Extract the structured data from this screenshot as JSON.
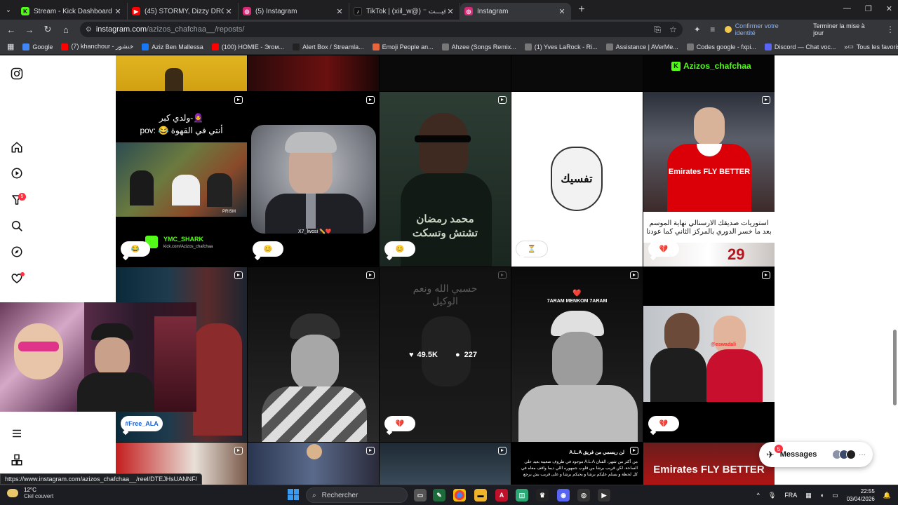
{
  "browser": {
    "tabs": [
      {
        "title": "Stream - Kick Dashboard",
        "color": "#53fc18",
        "glyph": "K",
        "active": false
      },
      {
        "title": "(45) STORMY, Dizzy DROS - NI",
        "color": "#ff0000",
        "glyph": "▶",
        "active": false
      },
      {
        "title": "(5) Instagram",
        "color": "#d62976",
        "glyph": "◎",
        "active": false
      },
      {
        "title": "TikTok | (xiil_w@) ⁻ ﻗﯿـــﺖ",
        "color": "#111111",
        "glyph": "♪",
        "active": false
      },
      {
        "title": "Instagram",
        "color": "#d62976",
        "glyph": "◎",
        "active": true
      }
    ],
    "url_host": "instagram.com",
    "url_path": "/azizos_chafchaa__/reposts/",
    "identity_label": "Confirmer votre identité",
    "update_label": "Terminer la mise à jour",
    "bookmarks": [
      {
        "label": "Google",
        "color": "#4285f4"
      },
      {
        "label": "(7) khanchour - خنشور",
        "color": "#ff0000"
      },
      {
        "label": "Aziz Ben Mallessa",
        "color": "#1877f2"
      },
      {
        "label": "(100) HOMIE - Эгом...",
        "color": "#ff0000"
      },
      {
        "label": "Alert Box / Streamla...",
        "color": "#222222"
      },
      {
        "label": "Emoji People an...",
        "color": "#e8643c"
      },
      {
        "label": "Ahzee (Songs Remix...",
        "color": "#777777"
      },
      {
        "label": "(1) Yves LaRock - Ri...",
        "color": "#777777"
      },
      {
        "label": "Assistance | AVerMe...",
        "color": "#777777"
      },
      {
        "label": "Codes google - fxpi...",
        "color": "#777777"
      },
      {
        "label": "Discord — Chat voc...",
        "color": "#5865f2"
      }
    ],
    "all_favorites_label": "Tous les favoris",
    "status_url": "https://www.instagram.com/azizos_chafchaa__/reel/DTEJHsUANNF/"
  },
  "instagram": {
    "nav_badge_reels": "5",
    "top_row": {
      "username_tag": "Azizos_chafchaa"
    },
    "posts": {
      "p1": {
        "line1": "ولدي كبر-🧕",
        "line2": "pov: 😂 أنتي في القهوة",
        "channel": "YMC_SHARK",
        "channel_sub": "kick.com/Azizos_chafchaa",
        "bubble": "😂",
        "watermark": "PRISM"
      },
      "p2": {
        "caption": "X7_lwosi ✏️❤️",
        "bubble": "😊"
      },
      "p3": {
        "title": "محمد رمضان",
        "subtitle": "تشتش وتسكت",
        "bubble": "😊"
      },
      "p4": {
        "logo_text": "تفسيك",
        "bubble": "⏳"
      },
      "p5": {
        "jersey": "Emirates FLY BETTER",
        "caption_l1": "استوريات صديقك الارسنالي نهاية الموسم",
        "caption_l2": "بعد ما خسر الدوري بالمركز الثاني كما عودنا",
        "number": "29",
        "bubble": "💔"
      },
      "p6": {
        "bubble": "#Free_ALA"
      },
      "p8": {
        "overlay_text_l1": "حسبي الله ونعم",
        "overlay_text_l2": "الوكيل",
        "likes": "49.5K",
        "comments": "227",
        "bubble": "💔"
      },
      "p9": {
        "overlay_text": "7ARAM MENKOM 7ARAM",
        "heart": "❤️"
      },
      "p10": {
        "overlay_text": "@eswadali",
        "bubble": "💔"
      },
      "p13": {
        "title": "A.L.A لن ريسمي من فريق",
        "body": "من أكثر من شهر، الفنان A.L.A موجود في ظروف صعيبة بعيد على الساحة. لكن قريب برشا من قلوب جمهوره اللي ديما واقف معاه في كل لحظة و يسلم عليكم برشا و يحبكم برشا و على قريب بش يرجع"
      },
      "p14": {
        "jersey": "Emirates FLY BETTER"
      }
    },
    "messages": {
      "label": "Messages",
      "badge": "5"
    }
  },
  "taskbar": {
    "weather_temp": "12°C",
    "weather_desc": "Ciel couvert",
    "search_placeholder": "Rechercher",
    "language": "FRA",
    "time": "22:55",
    "date": "03/04/2026"
  },
  "colors": {
    "instagram_badge": "#ff3040",
    "kick_green": "#53fc18",
    "arsenal_red": "#db0007"
  }
}
